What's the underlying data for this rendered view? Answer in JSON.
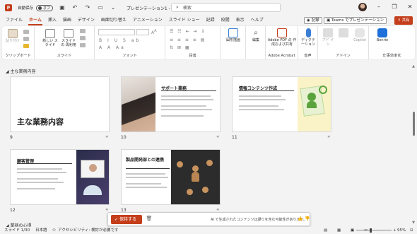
{
  "titlebar": {
    "app_letter": "P",
    "autosave_label": "自動保存",
    "autosave_state": "オフ",
    "doc_title": "プレゼンテーション1 - Power…",
    "search_placeholder": "検索",
    "icons": [
      "save-icon",
      "undo-icon",
      "redo-icon",
      "present-icon",
      "customize-icon"
    ]
  },
  "tabs": [
    "ファイル",
    "ホーム",
    "挿入",
    "描画",
    "デザイン",
    "画面切り替え",
    "アニメーション",
    "スライド ショー",
    "記録",
    "校閲",
    "表示",
    "ヘルプ"
  ],
  "active_tab": "ホーム",
  "header_buttons": {
    "record": "記録",
    "teams": "Teams でプレゼンテーション",
    "share": "共有"
  },
  "ribbon": {
    "groups": [
      {
        "label": "クリップボード",
        "buttons": [
          "貼り付け"
        ]
      },
      {
        "label": "スライド",
        "buttons": [
          "新しい スライド",
          "スライドの 再利用"
        ]
      },
      {
        "label": "フォント",
        "buttons": []
      },
      {
        "label": "段落",
        "buttons": []
      },
      {
        "label": "",
        "buttons": [
          "図形描画"
        ]
      },
      {
        "label": "",
        "buttons": [
          "編集"
        ]
      },
      {
        "label": "Adobe Acrobat",
        "buttons": [
          "Adobe PDF の 作成および共有"
        ]
      },
      {
        "label": "音声",
        "buttons": [
          "ディクテーション"
        ]
      },
      {
        "label": "アドイン",
        "buttons": [
          "アド イン",
          "Copilot"
        ]
      },
      {
        "label": "仕事効率化",
        "buttons": [
          "Benrie"
        ]
      }
    ]
  },
  "section": {
    "title": "主な業務内容"
  },
  "slides": [
    {
      "num": "9",
      "title": "主な業務内容"
    },
    {
      "num": "10",
      "title": "サポート業務"
    },
    {
      "num": "11",
      "title": "情報コンテンツ作成"
    },
    {
      "num": "12",
      "title": "顧客管理"
    },
    {
      "num": "13",
      "title": "製品開発部との連携"
    }
  ],
  "bottom_section": {
    "title": "業務の心得"
  },
  "notification": {
    "keep_label": "保持する",
    "message": "AI で生成されたコンテンツは誤りを含む可能性があります。"
  },
  "statusbar": {
    "slide_info": "スライド 1/30",
    "language": "日本語",
    "accessibility": "アクセシビリティ: 検討が必要です",
    "zoom": "95%"
  },
  "colors": {
    "accent": "#c43e1c"
  }
}
